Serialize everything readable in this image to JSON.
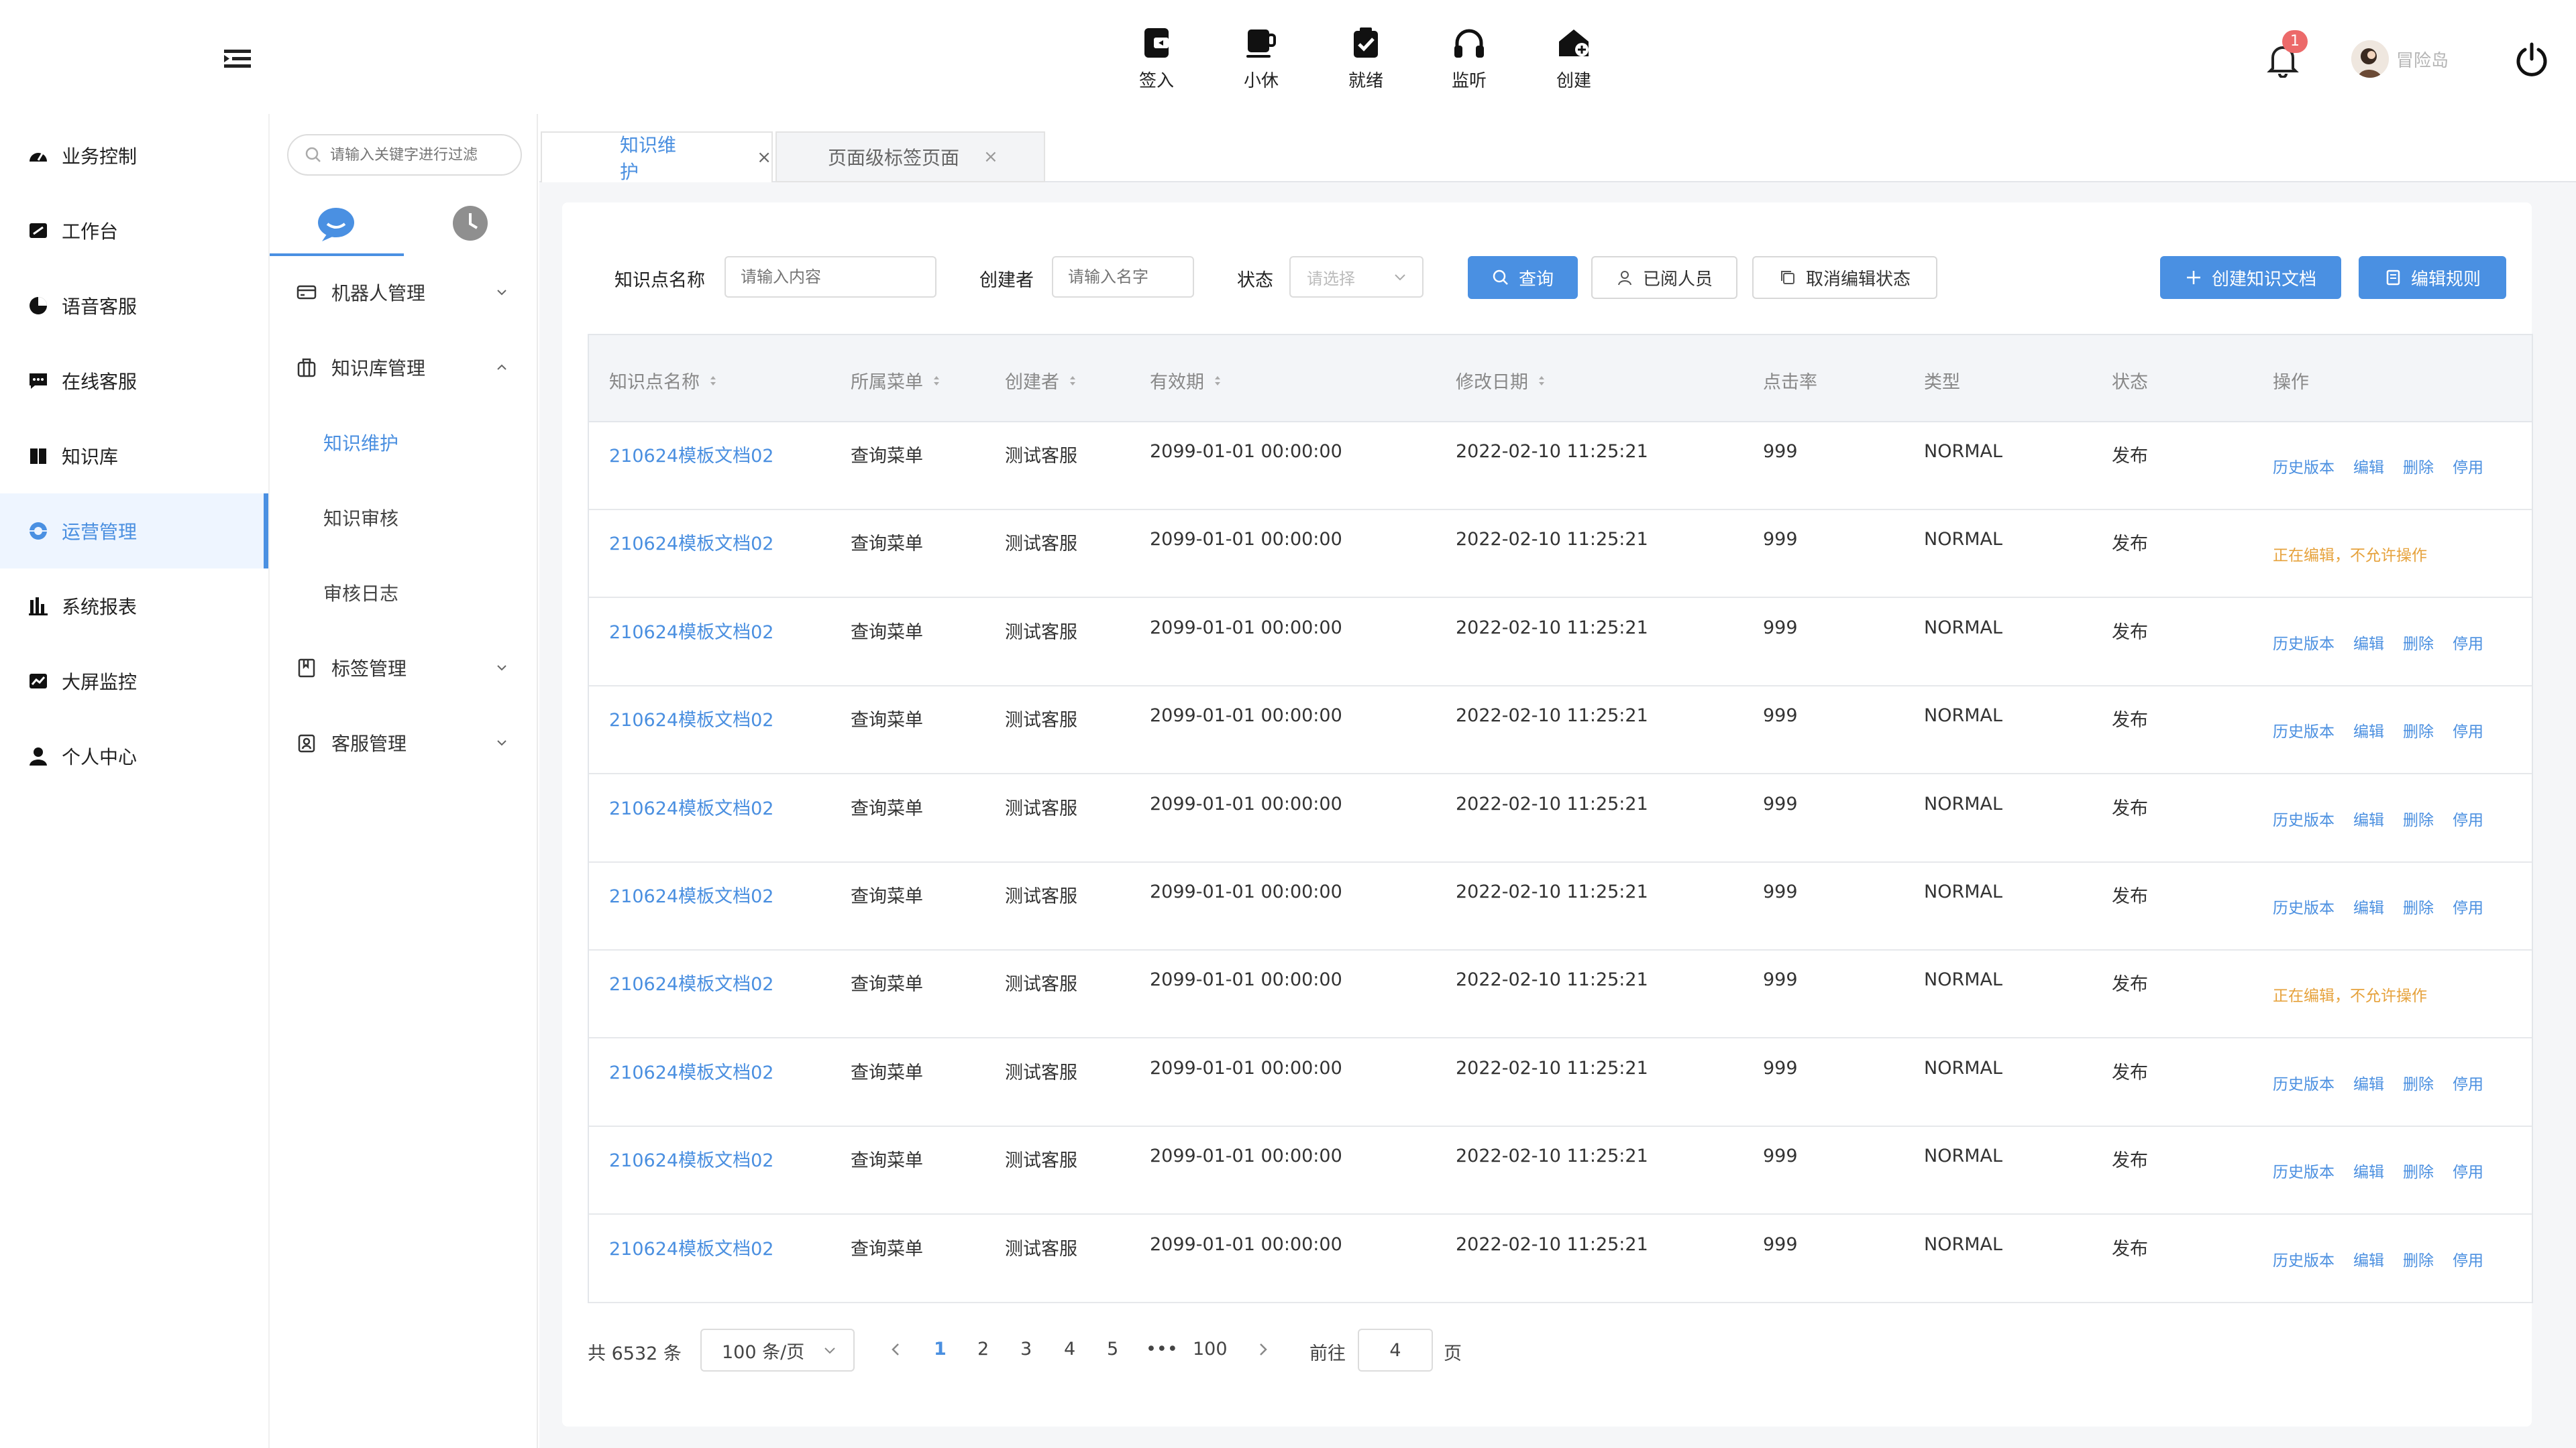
{
  "topbar": {
    "actions": [
      {
        "label": "签入",
        "icon": "sign-in-icon"
      },
      {
        "label": "小休",
        "icon": "coffee-break-icon"
      },
      {
        "label": "就绪",
        "icon": "ready-clipboard-icon"
      },
      {
        "label": "监听",
        "icon": "headset-icon"
      },
      {
        "label": "创建",
        "icon": "create-home-icon"
      }
    ],
    "notification_count": "1",
    "username": "冒险岛"
  },
  "sidebar": {
    "items": [
      {
        "label": "业务控制",
        "icon": "dashboard-icon"
      },
      {
        "label": "工作台",
        "icon": "workbench-icon"
      },
      {
        "label": "语音客服",
        "icon": "voice-service-icon"
      },
      {
        "label": "在线客服",
        "icon": "chat-service-icon"
      },
      {
        "label": "知识库",
        "icon": "book-icon"
      },
      {
        "label": "运营管理",
        "icon": "operations-icon",
        "active": true
      },
      {
        "label": "系统报表",
        "icon": "bar-chart-icon"
      },
      {
        "label": "大屏监控",
        "icon": "monitor-chart-icon"
      },
      {
        "label": "个人中心",
        "icon": "user-icon"
      }
    ]
  },
  "subpanel": {
    "search_placeholder": "请输入关键字进行过滤",
    "groups": [
      {
        "label": "机器人管理",
        "icon": "robot-card-icon",
        "expanded": false
      },
      {
        "label": "知识库管理",
        "icon": "knowledge-box-icon",
        "expanded": true
      },
      {
        "label": "标签管理",
        "icon": "tag-book-icon",
        "expanded": false
      },
      {
        "label": "客服管理",
        "icon": "service-badge-icon",
        "expanded": false
      }
    ],
    "children": [
      {
        "label": "知识维护",
        "active": true
      },
      {
        "label": "知识审核"
      },
      {
        "label": "审核日志"
      }
    ]
  },
  "tabs": [
    {
      "label": "知识维护",
      "close": "×",
      "active": true
    },
    {
      "label": "页面级标签页面",
      "close": "×",
      "active": false
    }
  ],
  "filters": {
    "name_label": "知识点名称",
    "name_placeholder": "请输入内容",
    "creator_label": "创建者",
    "creator_placeholder": "请输入名字",
    "status_label": "状态",
    "status_placeholder": "请选择",
    "query_btn": "查询",
    "readers_btn": "已阅人员",
    "cancel_edit_btn": "取消编辑状态",
    "create_doc_btn": "创建知识文档",
    "edit_rule_btn": "编辑规则"
  },
  "table": {
    "columns": [
      "知识点名称",
      "所属菜单",
      "创建者",
      "有效期",
      "修改日期",
      "点击率",
      "类型",
      "状态",
      "操作"
    ],
    "rows": [
      {
        "name": "210624模板文档02",
        "menu": "查询菜单",
        "creator": "测试客服",
        "valid": "2099-01-01 00:00:00",
        "modified": "2022-02-10 11:25:21",
        "clicks": "999",
        "type": "NORMAL",
        "status": "发布",
        "editing": false
      },
      {
        "name": "210624模板文档02",
        "menu": "查询菜单",
        "creator": "测试客服",
        "valid": "2099-01-01 00:00:00",
        "modified": "2022-02-10 11:25:21",
        "clicks": "999",
        "type": "NORMAL",
        "status": "发布",
        "editing": true
      },
      {
        "name": "210624模板文档02",
        "menu": "查询菜单",
        "creator": "测试客服",
        "valid": "2099-01-01 00:00:00",
        "modified": "2022-02-10 11:25:21",
        "clicks": "999",
        "type": "NORMAL",
        "status": "发布",
        "editing": false
      },
      {
        "name": "210624模板文档02",
        "menu": "查询菜单",
        "creator": "测试客服",
        "valid": "2099-01-01 00:00:00",
        "modified": "2022-02-10 11:25:21",
        "clicks": "999",
        "type": "NORMAL",
        "status": "发布",
        "editing": false
      },
      {
        "name": "210624模板文档02",
        "menu": "查询菜单",
        "creator": "测试客服",
        "valid": "2099-01-01 00:00:00",
        "modified": "2022-02-10 11:25:21",
        "clicks": "999",
        "type": "NORMAL",
        "status": "发布",
        "editing": false
      },
      {
        "name": "210624模板文档02",
        "menu": "查询菜单",
        "creator": "测试客服",
        "valid": "2099-01-01 00:00:00",
        "modified": "2022-02-10 11:25:21",
        "clicks": "999",
        "type": "NORMAL",
        "status": "发布",
        "editing": false
      },
      {
        "name": "210624模板文档02",
        "menu": "查询菜单",
        "creator": "测试客服",
        "valid": "2099-01-01 00:00:00",
        "modified": "2022-02-10 11:25:21",
        "clicks": "999",
        "type": "NORMAL",
        "status": "发布",
        "editing": true
      },
      {
        "name": "210624模板文档02",
        "menu": "查询菜单",
        "creator": "测试客服",
        "valid": "2099-01-01 00:00:00",
        "modified": "2022-02-10 11:25:21",
        "clicks": "999",
        "type": "NORMAL",
        "status": "发布",
        "editing": false
      },
      {
        "name": "210624模板文档02",
        "menu": "查询菜单",
        "creator": "测试客服",
        "valid": "2099-01-01 00:00:00",
        "modified": "2022-02-10 11:25:21",
        "clicks": "999",
        "type": "NORMAL",
        "status": "发布",
        "editing": false
      },
      {
        "name": "210624模板文档02",
        "menu": "查询菜单",
        "creator": "测试客服",
        "valid": "2099-01-01 00:00:00",
        "modified": "2022-02-10 11:25:21",
        "clicks": "999",
        "type": "NORMAL",
        "status": "发布",
        "editing": false
      }
    ],
    "ops": [
      "历史版本",
      "编辑",
      "删除",
      "停用"
    ],
    "editing_text": "正在编辑，不允许操作"
  },
  "pagination": {
    "total": "共 6532 条",
    "page_size": "100 条/页",
    "pages": [
      "1",
      "2",
      "3",
      "4",
      "5",
      "•••",
      "100"
    ],
    "current": "1",
    "goto_label": "前往",
    "goto_value": "4",
    "goto_suffix": "页"
  },
  "colors": {
    "accent": "#4a90e2",
    "warning": "#e6a23c",
    "badge": "#ec6a6a"
  }
}
